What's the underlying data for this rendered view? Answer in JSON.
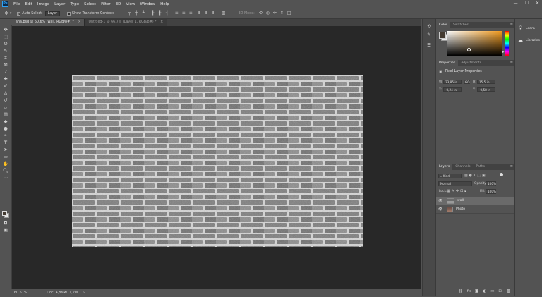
{
  "app": {
    "logo_text": "Ps"
  },
  "menu": [
    "File",
    "Edit",
    "Image",
    "Layer",
    "Type",
    "Select",
    "Filter",
    "3D",
    "View",
    "Window",
    "Help"
  ],
  "window_controls": {
    "minimize": "—",
    "maximize": "☐",
    "close": "✕"
  },
  "options_bar": {
    "auto_select_label": "Auto-Select:",
    "auto_select_target": "Layer",
    "transform_controls_label": "Show Transform Controls",
    "mode_3d_label": "3D Mode:"
  },
  "tabs": [
    {
      "label": "ana.psd @ 60.6% (wall, RGB/8#) *",
      "close": "×"
    },
    {
      "label": "Untitled-1 @ 66.7% (Layer 1, RGB/8#) *",
      "close": "×"
    }
  ],
  "status": {
    "zoom": "60.61%",
    "doc": "Doc: 4,86M/11,2M",
    "arrow": "›"
  },
  "color_panel": {
    "tabs": [
      "Color",
      "Swatches"
    ],
    "fg_color": "#433a30",
    "bg_color": "#e8e8e8",
    "hue": "#f39c1f"
  },
  "properties_panel": {
    "tabs": [
      "Properties",
      "Adjustments"
    ],
    "title": "Pixel Layer Properties",
    "w_label": "W:",
    "w_value": "23,85 in",
    "link_label": "GO",
    "h_label": "H:",
    "h_value": "15,5 in",
    "x_label": "X:",
    "x_value": "-0,24 in",
    "y_label": "Y:",
    "y_value": "-0,58 in"
  },
  "layers_panel": {
    "tabs": [
      "Layers",
      "Channels",
      "Paths"
    ],
    "filter_label": "Kind",
    "blend_mode": "Normal",
    "opacity_label": "Opacity:",
    "opacity_value": "100%",
    "lock_label": "Lock:",
    "fill_label": "Fill:",
    "fill_value": "100%",
    "layers": [
      {
        "name": "wall",
        "selected": true
      },
      {
        "name": "Photo",
        "selected": false
      }
    ],
    "footer_icons": [
      "link-icon",
      "fx-icon",
      "mask-icon",
      "adjustment-icon",
      "group-icon",
      "new-layer-icon",
      "trash-icon"
    ]
  },
  "libraries": {
    "items": [
      {
        "label": "Learn",
        "icon": "bulb-icon"
      },
      {
        "label": "Libraries",
        "icon": "cloud-icon"
      }
    ]
  }
}
